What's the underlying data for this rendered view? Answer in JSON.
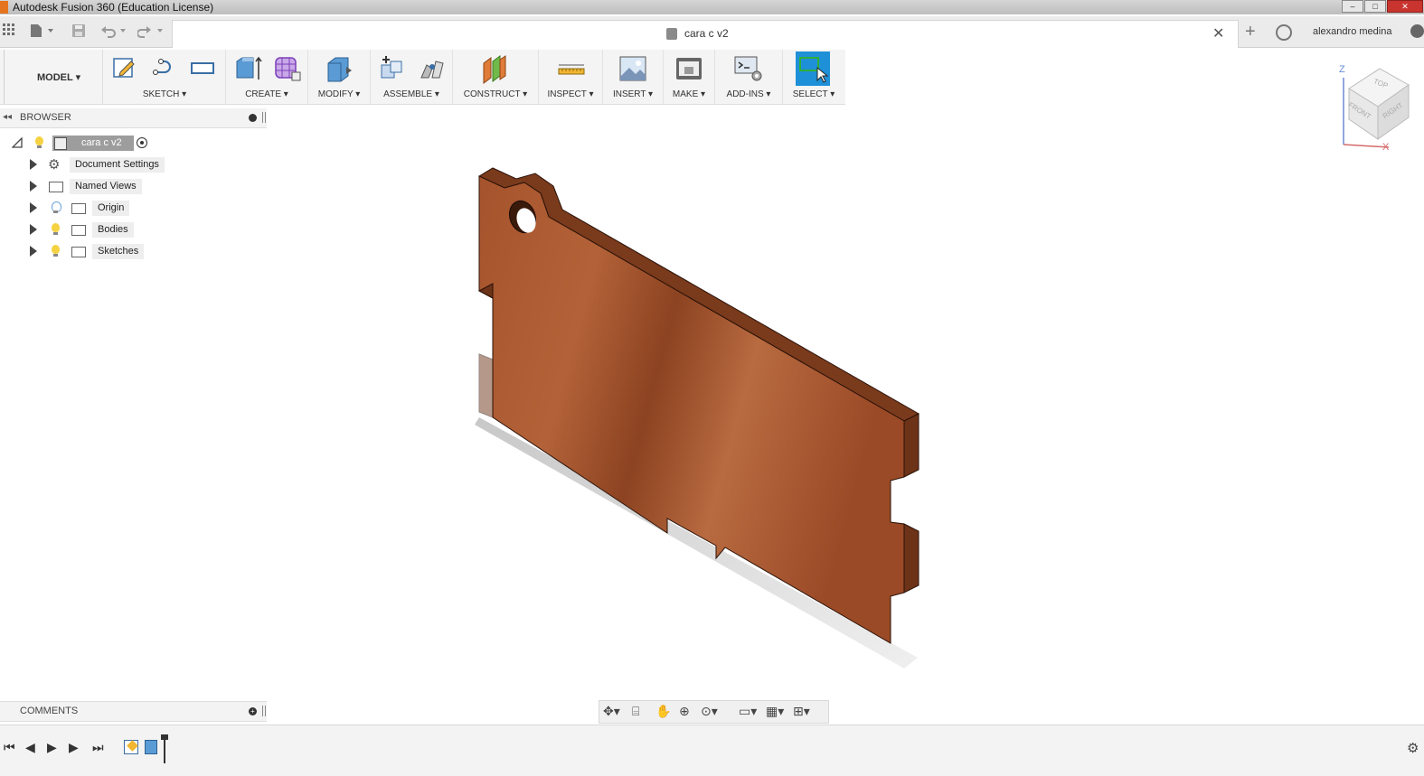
{
  "window": {
    "title": "Autodesk Fusion 360 (Education License)",
    "minimize": "–",
    "maximize": "□",
    "close": "✕"
  },
  "tabrow": {
    "document_tab": "cara c v2",
    "close_glyph": "✕",
    "new_tab_glyph": "+",
    "user": "alexandro medina"
  },
  "toolbar": {
    "workspace": "MODEL ▾",
    "groups": [
      {
        "label": "SKETCH ▾"
      },
      {
        "label": "CREATE ▾"
      },
      {
        "label": "MODIFY ▾"
      },
      {
        "label": "ASSEMBLE ▾"
      },
      {
        "label": "CONSTRUCT ▾"
      },
      {
        "label": "INSPECT ▾"
      },
      {
        "label": "INSERT ▾"
      },
      {
        "label": "MAKE ▾"
      },
      {
        "label": "ADD-INS ▾"
      },
      {
        "label": "SELECT ▾"
      }
    ]
  },
  "browser": {
    "title": "BROWSER",
    "root": "cara c v2",
    "items": [
      {
        "label": "Document Settings",
        "icon": "gear-icon"
      },
      {
        "label": "Named Views",
        "icon": "folder-icon"
      },
      {
        "label": "Origin",
        "icon": "folder-icon"
      },
      {
        "label": "Bodies",
        "icon": "folder-icon"
      },
      {
        "label": "Sketches",
        "icon": "folder-icon"
      }
    ]
  },
  "comments": {
    "label": "COMMENTS"
  },
  "viewcube": {
    "top": "TOP",
    "front": "FRONT",
    "right": "RIGHT",
    "z": "Z",
    "x": "X"
  },
  "colors": {
    "wood_light": "#b5633a",
    "wood_dark": "#7a3a1c",
    "select_accent": "#1e90d8"
  }
}
